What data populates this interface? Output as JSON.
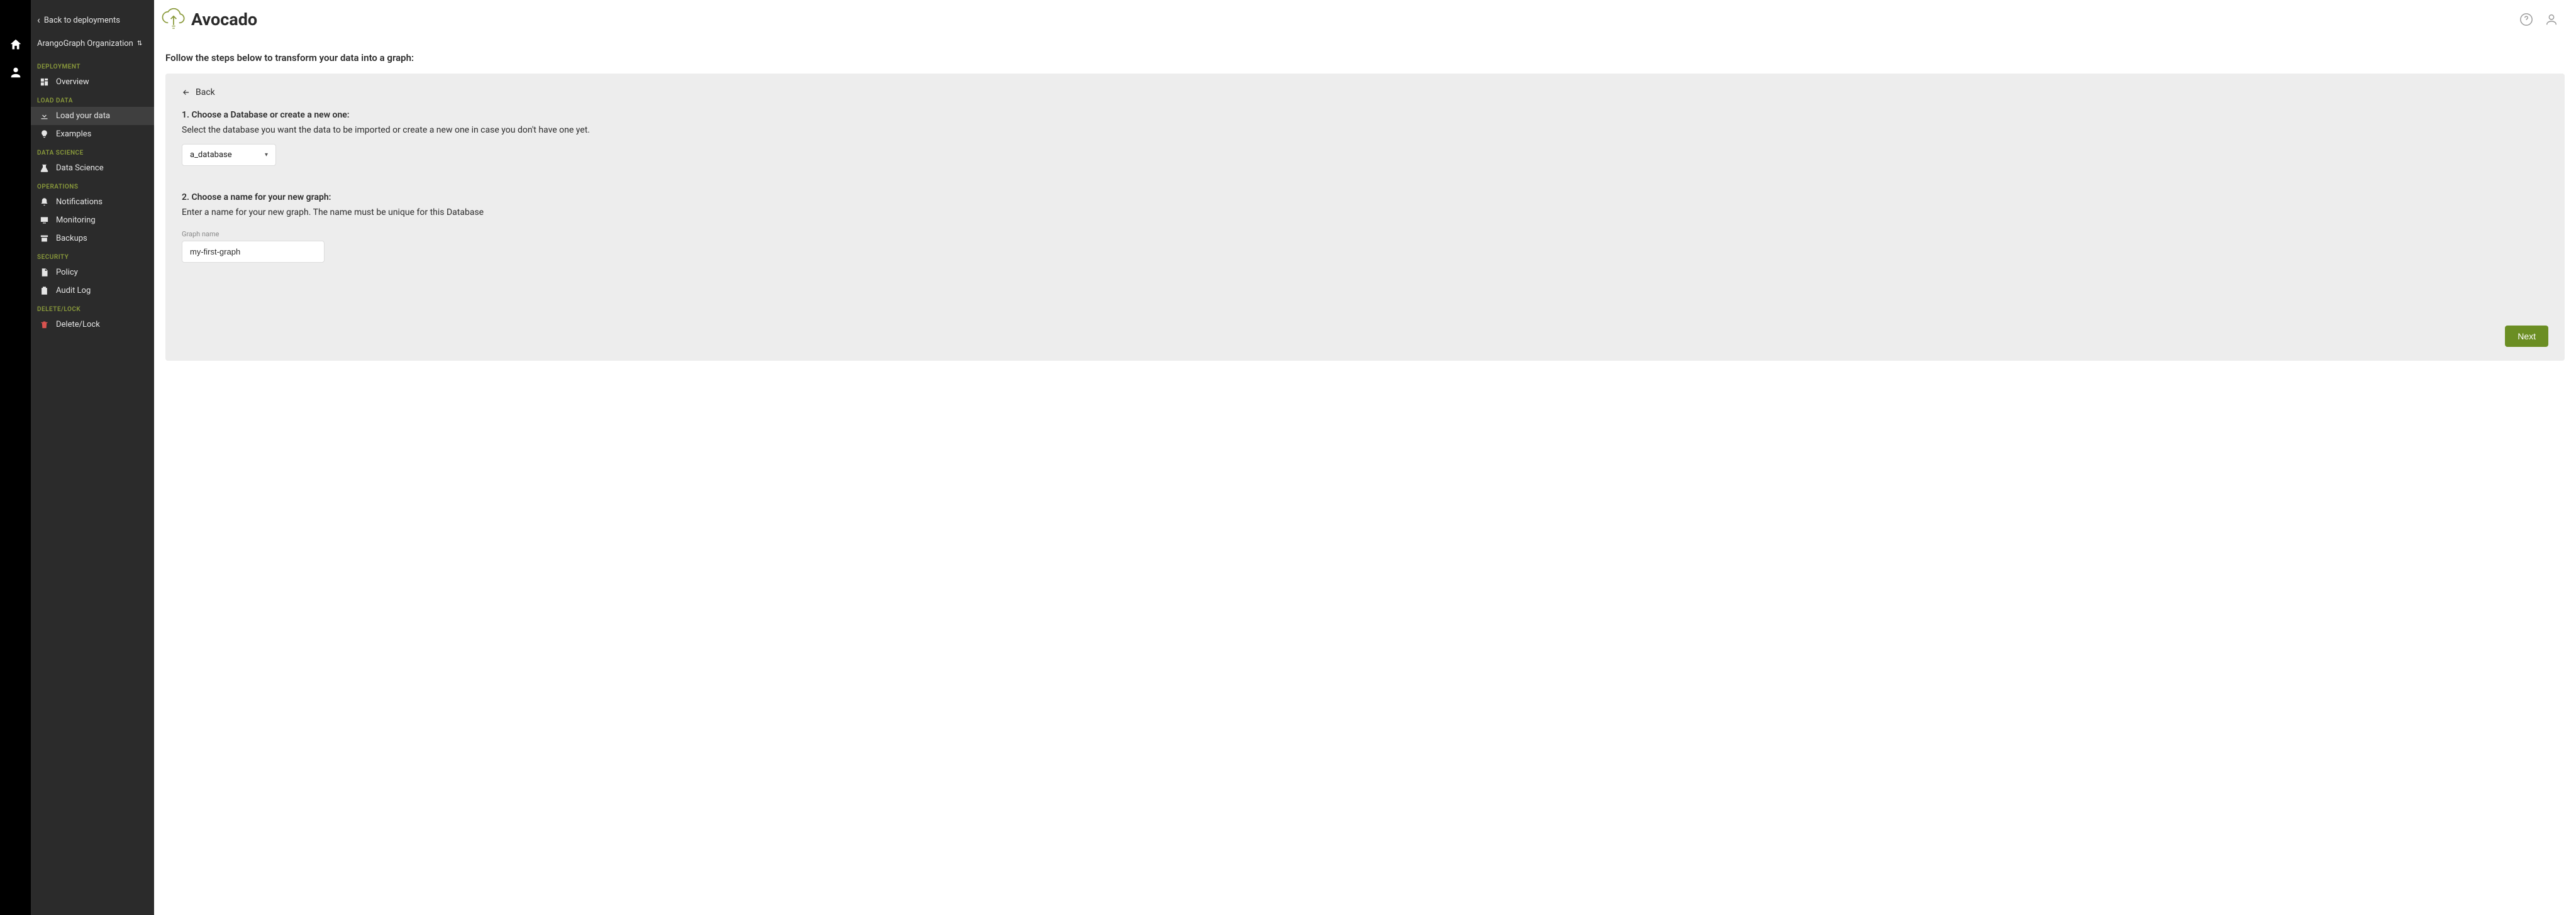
{
  "rail": {
    "home": "home-icon",
    "users": "users-icon"
  },
  "sidebar": {
    "back_label": "Back to deployments",
    "org_label": "ArangoGraph Organization",
    "sections": {
      "deployment": {
        "header": "DEPLOYMENT",
        "items": [
          {
            "label": "Overview"
          }
        ]
      },
      "load_data": {
        "header": "LOAD DATA",
        "items": [
          {
            "label": "Load your data"
          },
          {
            "label": "Examples"
          }
        ]
      },
      "data_science": {
        "header": "DATA SCIENCE",
        "items": [
          {
            "label": "Data Science"
          }
        ]
      },
      "operations": {
        "header": "OPERATIONS",
        "items": [
          {
            "label": "Notifications"
          },
          {
            "label": "Monitoring"
          },
          {
            "label": "Backups"
          }
        ]
      },
      "security": {
        "header": "SECURITY",
        "items": [
          {
            "label": "Policy"
          },
          {
            "label": "Audit Log"
          }
        ]
      },
      "delete_lock": {
        "header": "DELETE/LOCK",
        "items": [
          {
            "label": "Delete/Lock"
          }
        ]
      }
    }
  },
  "header": {
    "title": "Avocado"
  },
  "main": {
    "instruction": "Follow the steps below to transform your data into a graph:",
    "back_label": "Back",
    "step1": {
      "title": "1. Choose a Database or create a new one:",
      "desc": "Select the database you want the data to be imported or create a new one in case you don't have one yet.",
      "selected": "a_database"
    },
    "step2": {
      "title": "2. Choose a name for your new graph:",
      "desc": "Enter a name for your new graph. The name must be unique for this Database",
      "label": "Graph name",
      "value": "my-first-graph"
    },
    "next_label": "Next"
  }
}
